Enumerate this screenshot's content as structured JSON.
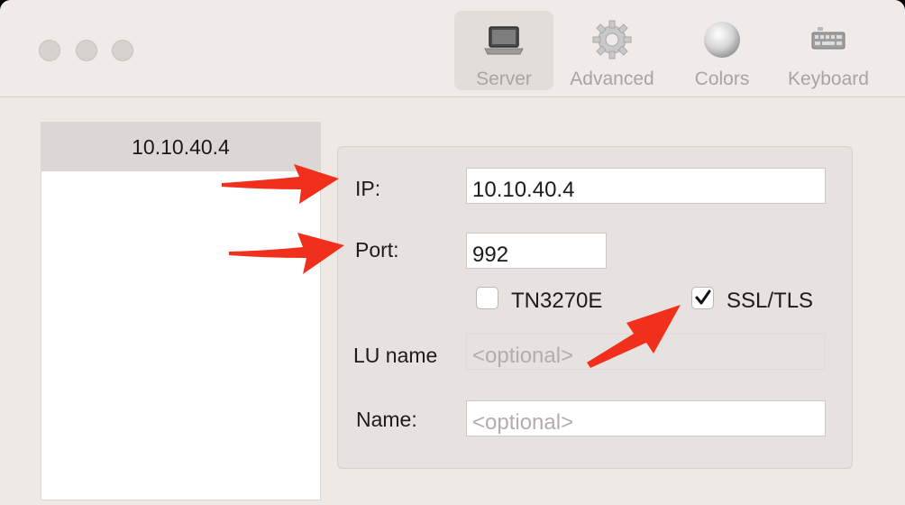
{
  "toolbar": {
    "items": [
      {
        "label": "Server",
        "icon": "laptop-icon",
        "active": true
      },
      {
        "label": "Advanced",
        "icon": "gear-icon",
        "active": false
      },
      {
        "label": "Colors",
        "icon": "sphere-icon",
        "active": false
      },
      {
        "label": "Keyboard",
        "icon": "keyboard-icon",
        "active": false
      }
    ]
  },
  "sidebar": {
    "items": [
      {
        "label": "10.10.40.4",
        "selected": true
      }
    ]
  },
  "form": {
    "ip_label": "IP:",
    "ip_value": "10.10.40.4",
    "port_label": "Port:",
    "port_value": "992",
    "tn3270e_label": "TN3270E",
    "tn3270e_checked": false,
    "ssl_label": "SSL/TLS",
    "ssl_checked": true,
    "lu_label": "LU name",
    "lu_placeholder": "<optional>",
    "name_label": "Name:",
    "name_placeholder": "<optional>"
  },
  "colors": {
    "arrow": "#f0301c",
    "window_bg": "#efe9e6"
  }
}
